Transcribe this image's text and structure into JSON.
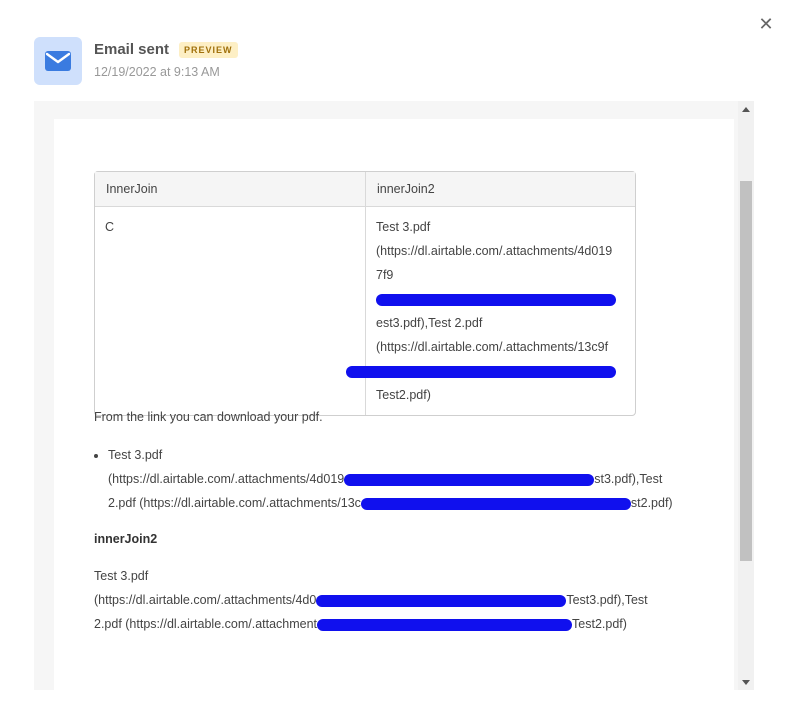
{
  "header": {
    "title": "Email sent",
    "badge": "PREVIEW",
    "timestamp": "12/19/2022 at 9:13 AM",
    "icon": "envelope-icon",
    "accent_color": "#3a7be0"
  },
  "table": {
    "headers": [
      "InnerJoin",
      "innerJoin2"
    ],
    "row": {
      "col1": "C",
      "col2_lines": [
        "Test 3.pdf",
        "(https://dl.airtable.com/.attachments/4d019",
        "7f9",
        "est3.pdf),Test 2.pdf",
        "(https://dl.airtable.com/.attachments/13c9f",
        "",
        "Test2.pdf)"
      ]
    }
  },
  "body": {
    "intro": "From the link you can download your pdf.",
    "bullet_line1a": "Test 3.pdf",
    "bullet_line2a": "(https://dl.airtable.com/.attachments/4d019",
    "bullet_line2b": "st3.pdf),Test",
    "bullet_line3a": "2.pdf (https://dl.airtable.com/.attachments/13c",
    "bullet_line3b": "st2.pdf)",
    "section_title": "innerJoin2",
    "para_line1": "Test 3.pdf",
    "para_line2a": "(https://dl.airtable.com/.attachments/4d0",
    "para_line2b": "Test3.pdf),Test",
    "para_line3a": "2.pdf (https://dl.airtable.com/.attachment",
    "para_line3b": "Test2.pdf)"
  }
}
